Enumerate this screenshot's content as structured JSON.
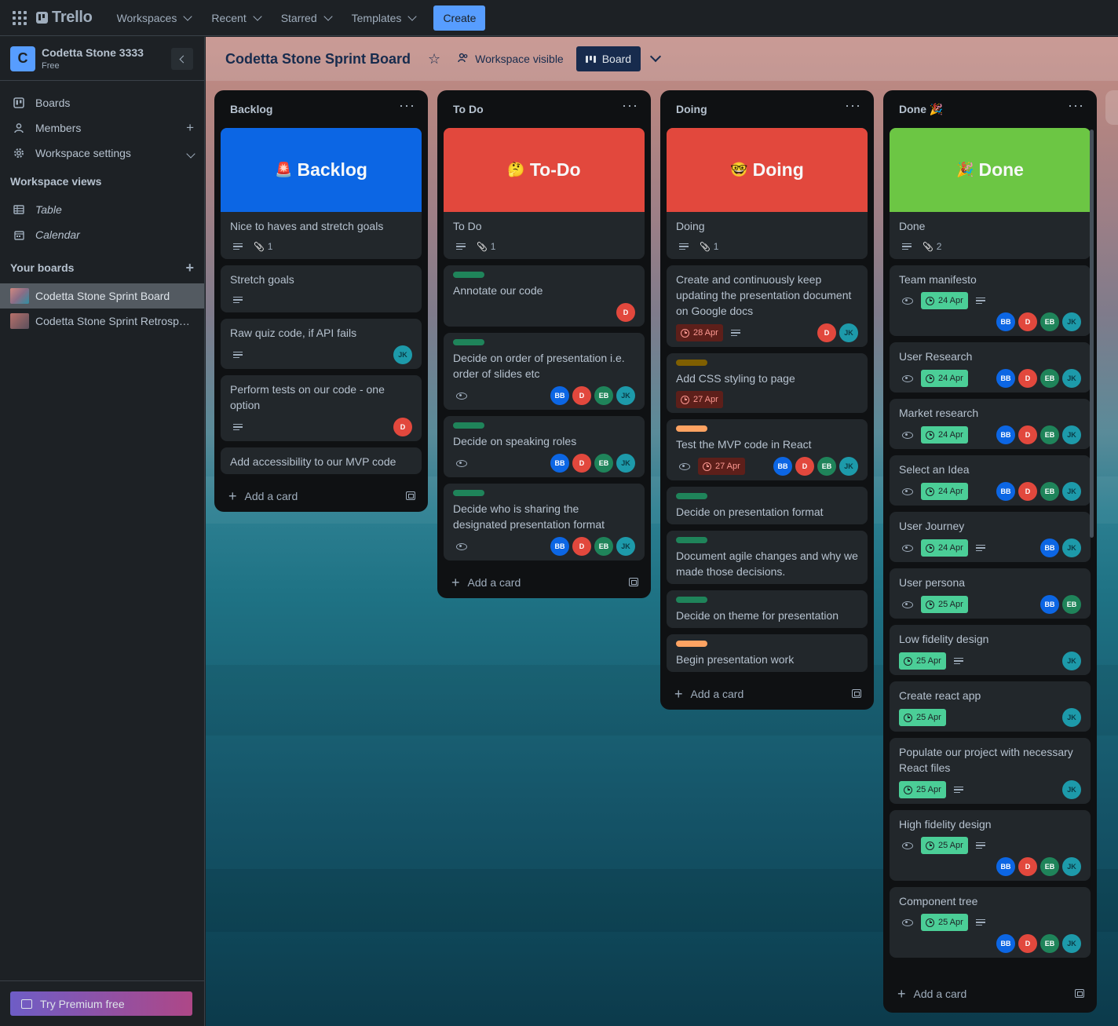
{
  "nav": {
    "logo": "Trello",
    "items": [
      "Workspaces",
      "Recent",
      "Starred",
      "Templates"
    ],
    "create_label": "Create"
  },
  "sidebar": {
    "workspace_initial": "C",
    "workspace_name": "Codetta Stone 3333",
    "workspace_plan": "Free",
    "items": [
      {
        "label": "Boards",
        "icon": "board-icon"
      },
      {
        "label": "Members",
        "icon": "person-icon"
      },
      {
        "label": "Workspace settings",
        "icon": "gear-icon"
      }
    ],
    "views_title": "Workspace views",
    "views": [
      {
        "label": "Table",
        "icon": "table-icon"
      },
      {
        "label": "Calendar",
        "icon": "calendar-icon"
      }
    ],
    "boards_title": "Your boards",
    "boards": [
      {
        "label": "Codetta Stone Sprint Board",
        "active": true
      },
      {
        "label": "Codetta Stone Sprint Retrosp…",
        "active": false
      }
    ],
    "premium_label": "Try Premium free"
  },
  "board": {
    "title": "Codetta Stone Sprint Board",
    "visibility": "Workspace visible",
    "view": "Board",
    "add_card_label": "Add a card",
    "colors": {
      "green_label": "#1f845a",
      "yellow_label": "#7f5f01",
      "orange_label": "#fea362",
      "date_green": "#4bce97",
      "date_red": "#5d1f1a"
    },
    "lists": [
      {
        "title": "Backlog",
        "cards": [
          {
            "cover": {
              "color": "#0c66e4",
              "emoji": "🚨",
              "text": "Backlog"
            },
            "title": "Nice to haves and stretch goals",
            "desc": true,
            "attachments": "1"
          },
          {
            "title": "Stretch goals",
            "desc": true
          },
          {
            "title": "Raw quiz code, if API fails",
            "desc": true,
            "members": [
              "JK"
            ]
          },
          {
            "title": "Perform tests on our code - one option",
            "desc": true,
            "members": [
              "D"
            ]
          },
          {
            "title": "Add accessibility to our MVP code"
          }
        ]
      },
      {
        "title": "To Do",
        "cards": [
          {
            "cover": {
              "color": "#e2483d",
              "emoji": "🤔",
              "text": "To-Do"
            },
            "title": "To Do",
            "desc": true,
            "attachments": "1"
          },
          {
            "label": "green",
            "title": "Annotate our code",
            "members": [
              "D"
            ]
          },
          {
            "label": "green",
            "title": "Decide on order of presentation i.e. order of slides etc",
            "watch": true,
            "members": [
              "BB",
              "D",
              "EB",
              "JK"
            ]
          },
          {
            "label": "green",
            "title": "Decide on speaking roles",
            "watch": true,
            "members": [
              "BB",
              "D",
              "EB",
              "JK"
            ]
          },
          {
            "label": "green",
            "title": "Decide who is sharing the designated presentation format",
            "watch": true,
            "members": [
              "BB",
              "D",
              "EB",
              "JK"
            ]
          }
        ]
      },
      {
        "title": "Doing",
        "cards": [
          {
            "cover": {
              "color": "#e2483d",
              "emoji": "🤓",
              "text": "Doing"
            },
            "title": "Doing",
            "desc": true,
            "attachments": "1"
          },
          {
            "title": "Create and continuously keep updating the presentation document on Google docs",
            "date": "28 Apr",
            "date_style": "red",
            "desc_after": true,
            "members": [
              "D",
              "JK"
            ]
          },
          {
            "label": "yellow",
            "title": "Add CSS styling to page",
            "date": "27 Apr",
            "date_style": "red"
          },
          {
            "label": "orange",
            "title": "Test the MVP code in React",
            "watch": true,
            "date": "27 Apr",
            "date_style": "red",
            "members": [
              "BB",
              "D",
              "EB",
              "JK"
            ]
          },
          {
            "label": "green",
            "title": "Decide on presentation format"
          },
          {
            "label": "green",
            "title": "Document agile changes and why we made those decisions."
          },
          {
            "label": "green",
            "title": "Decide on theme for presentation"
          },
          {
            "label": "orange",
            "title": "Begin presentation work"
          }
        ]
      },
      {
        "title": "Done 🎉",
        "cards": [
          {
            "cover": {
              "color": "#4bce97",
              "emoji": "🎉",
              "text": "Done",
              "tint": "#6cc644"
            },
            "title": "Done",
            "desc": true,
            "attachments": "2"
          },
          {
            "title": "Team manifesto",
            "watch": true,
            "date": "24 Apr",
            "date_style": "green",
            "desc_after": true,
            "members_row": [
              "BB",
              "D",
              "EB",
              "JK"
            ]
          },
          {
            "title": "User Research",
            "watch": true,
            "date": "24 Apr",
            "date_style": "green",
            "members": [
              "BB",
              "D",
              "EB",
              "JK"
            ]
          },
          {
            "title": "Market research",
            "watch": true,
            "date": "24 Apr",
            "date_style": "green",
            "members": [
              "BB",
              "D",
              "EB",
              "JK"
            ]
          },
          {
            "title": "Select an Idea",
            "watch": true,
            "date": "24 Apr",
            "date_style": "green",
            "members": [
              "BB",
              "D",
              "EB",
              "JK"
            ]
          },
          {
            "title": "User Journey",
            "watch": true,
            "date": "24 Apr",
            "date_style": "green",
            "desc_after": true,
            "members": [
              "BB",
              "JK"
            ]
          },
          {
            "title": "User persona",
            "watch": true,
            "date": "25 Apr",
            "date_style": "green",
            "members": [
              "BB",
              "EB"
            ]
          },
          {
            "title": "Low fidelity design",
            "date": "25 Apr",
            "date_style": "green",
            "desc_after": true,
            "members": [
              "JK"
            ]
          },
          {
            "title": "Create react app",
            "date": "25 Apr",
            "date_style": "green",
            "members": [
              "JK"
            ]
          },
          {
            "title": "Populate our project with necessary React files",
            "date": "25 Apr",
            "date_style": "green",
            "desc_after": true,
            "members": [
              "JK"
            ]
          },
          {
            "title": "High fidelity design",
            "watch": true,
            "date": "25 Apr",
            "date_style": "green",
            "desc_after": true,
            "members_row": [
              "BB",
              "D",
              "EB",
              "JK"
            ]
          },
          {
            "title": "Component tree",
            "watch": true,
            "date": "25 Apr",
            "date_style": "green",
            "desc_after": true,
            "members_row": [
              "BB",
              "D",
              "EB",
              "JK"
            ]
          }
        ]
      }
    ]
  }
}
